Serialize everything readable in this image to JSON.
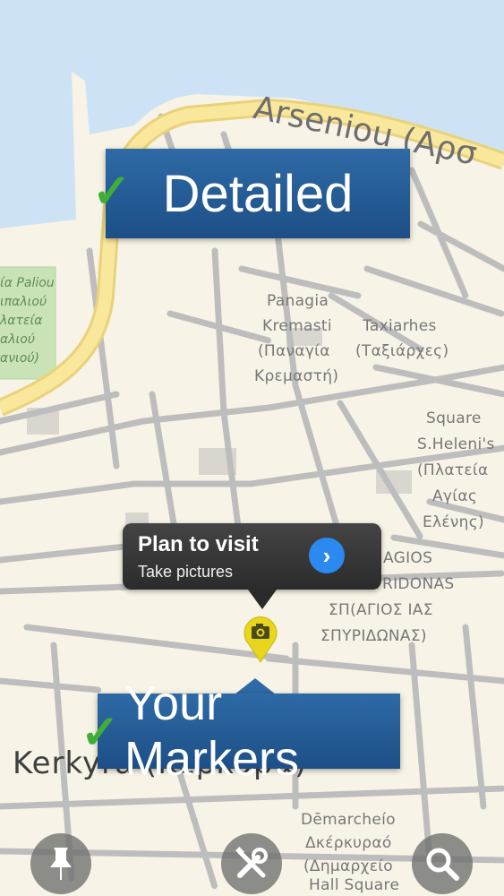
{
  "map": {
    "street_arseniou": "Arseniou (Αρσ",
    "town_name": "Kerkyra (Κέρκυρα)",
    "park_lines": [
      "ία Paliou",
      "ιπαλιού",
      "λατεία",
      "αλιού",
      "ανιού)"
    ],
    "labels": [
      {
        "id": "panagia-kremasti",
        "lines": [
          "Panagia",
          "Kremasti",
          "(Παναγία",
          "Κρεμαστή)"
        ]
      },
      {
        "id": "taxiarhes",
        "lines": [
          "Taxiarhes",
          "(Ταξιάρχες)"
        ]
      },
      {
        "id": "square-s-helenis",
        "lines": [
          "Square",
          "S.Heleni's",
          "(Πλατεία",
          "Αγίας",
          "Ελένης)"
        ]
      },
      {
        "id": "agios-spyridonas",
        "lines": [
          "AGIOS",
          "SPYRIDONAS",
          "ΣΠ(ΑΓΙΟΣ ΙΑΣ",
          "ΣΠΥΡΙΔΩΝΑΣ)"
        ]
      },
      {
        "id": "demarcheio",
        "lines": [
          "Dēmarcheío",
          "Δκέρκυραό",
          "(Δημαρχείο",
          "Hall Square"
        ]
      }
    ],
    "colors": {
      "land": "#f7f3e6",
      "water": "#cde3f5",
      "park": "#c9e3b6",
      "road_major": "#f5e08a",
      "road_minor": "#c9c9c9"
    }
  },
  "banners": {
    "detailed": "Detailed",
    "your_markers": "Your Markers",
    "check_glyph": "✓"
  },
  "callout": {
    "title": "Plan to visit",
    "subtitle": "Take pictures",
    "detail_icon": "chevron-right-icon"
  },
  "marker": {
    "icon": "camera-icon",
    "color": "#e8d61c"
  },
  "toolbar": {
    "buttons": [
      {
        "id": "pin",
        "icon": "pushpin-icon"
      },
      {
        "id": "tools",
        "icon": "tools-icon"
      },
      {
        "id": "search",
        "icon": "search-icon"
      }
    ]
  }
}
